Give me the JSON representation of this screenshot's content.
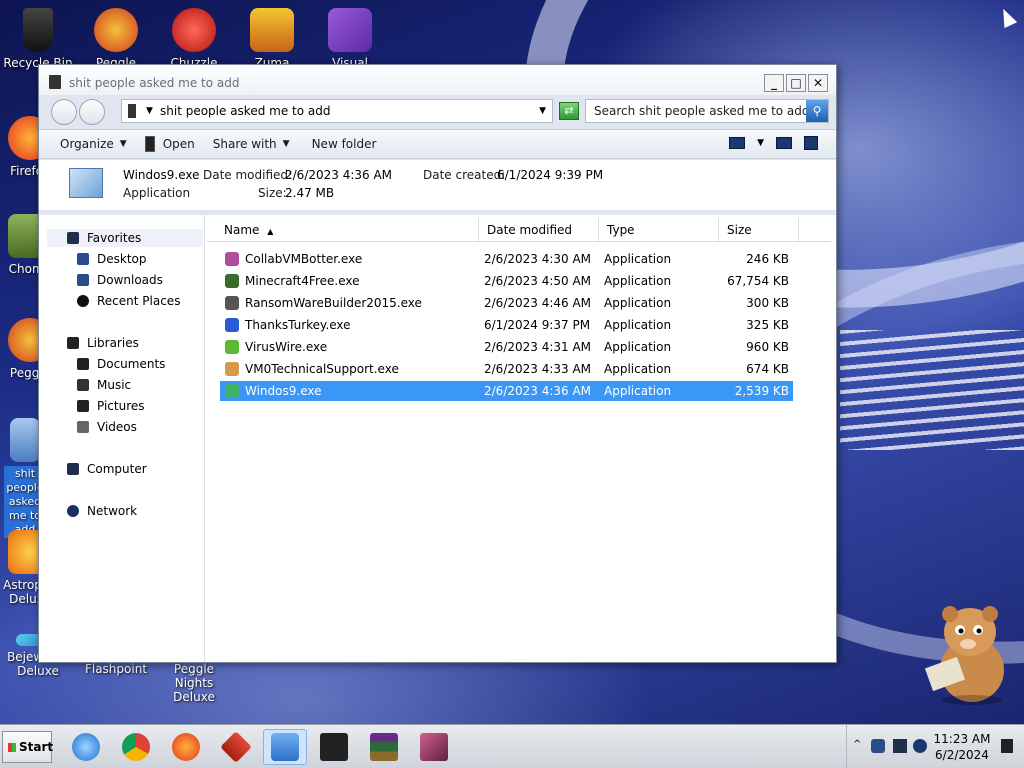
{
  "desktop": {
    "icons": [
      {
        "label": "Recycle Bin"
      },
      {
        "label": "Peggle World"
      },
      {
        "label": "Chuzzle"
      },
      {
        "label": "Zuma Deluxe"
      },
      {
        "label": "Visual Studio"
      },
      {
        "label": "Firefox"
      },
      {
        "label": "Chomp"
      },
      {
        "label": "Peggle"
      },
      {
        "label": "shit people asked me to add"
      },
      {
        "label": "Astropop Deluxe"
      },
      {
        "label": "Bejeweled Deluxe"
      },
      {
        "label": "Flashpoint"
      },
      {
        "label": "Peggle Nights Deluxe"
      }
    ]
  },
  "window": {
    "title": "shit people asked me to add",
    "controls": {
      "minimize": "_",
      "maximize": "□",
      "close": "✕"
    }
  },
  "address": {
    "path": "shit people asked me to add",
    "search_placeholder": "Search shit people asked me to add"
  },
  "toolbar": {
    "organize": "Organize",
    "open": "Open",
    "share_with": "Share with",
    "new_folder": "New folder"
  },
  "details": {
    "filename": "Windos9.exe",
    "type": "Application",
    "date_modified_label": "Date modified:",
    "date_modified": "2/6/2023 4:36 AM",
    "size_label": "Size:",
    "size": "2.47 MB",
    "date_created_label": "Date created:",
    "date_created": "6/1/2024 9:39 PM"
  },
  "nav": {
    "favorites": "Favorites",
    "desktop": "Desktop",
    "downloads": "Downloads",
    "recent": "Recent Places",
    "libraries": "Libraries",
    "documents": "Documents",
    "music": "Music",
    "pictures": "Pictures",
    "videos": "Videos",
    "computer": "Computer",
    "network": "Network"
  },
  "columns": {
    "name": "Name",
    "date_modified": "Date modified",
    "type": "Type",
    "size": "Size"
  },
  "files": [
    {
      "name": "CollabVMBotter.exe",
      "date": "2/6/2023 4:30 AM",
      "type": "Application",
      "size": "246 KB",
      "color": "#b04c9a"
    },
    {
      "name": "Minecraft4Free.exe",
      "date": "2/6/2023 4:50 AM",
      "type": "Application",
      "size": "67,754 KB",
      "color": "#3a6b2a"
    },
    {
      "name": "RansomWareBuilder2015.exe",
      "date": "2/6/2023 4:46 AM",
      "type": "Application",
      "size": "300 KB",
      "color": "#555555"
    },
    {
      "name": "ThanksTurkey.exe",
      "date": "6/1/2024 9:37 PM",
      "type": "Application",
      "size": "325 KB",
      "color": "#2a5bd6"
    },
    {
      "name": "VirusWire.exe",
      "date": "2/6/2023 4:31 AM",
      "type": "Application",
      "size": "960 KB",
      "color": "#5cb82e"
    },
    {
      "name": "VM0TechnicalSupport.exe",
      "date": "2/6/2023 4:33 AM",
      "type": "Application",
      "size": "674 KB",
      "color": "#d49a4a"
    },
    {
      "name": "Windos9.exe",
      "date": "2/6/2023 4:36 AM",
      "type": "Application",
      "size": "2,539 KB",
      "color": "#3fb06c"
    }
  ],
  "taskbar": {
    "start": "Start",
    "time": "11:23 AM",
    "date": "6/2/2024"
  }
}
